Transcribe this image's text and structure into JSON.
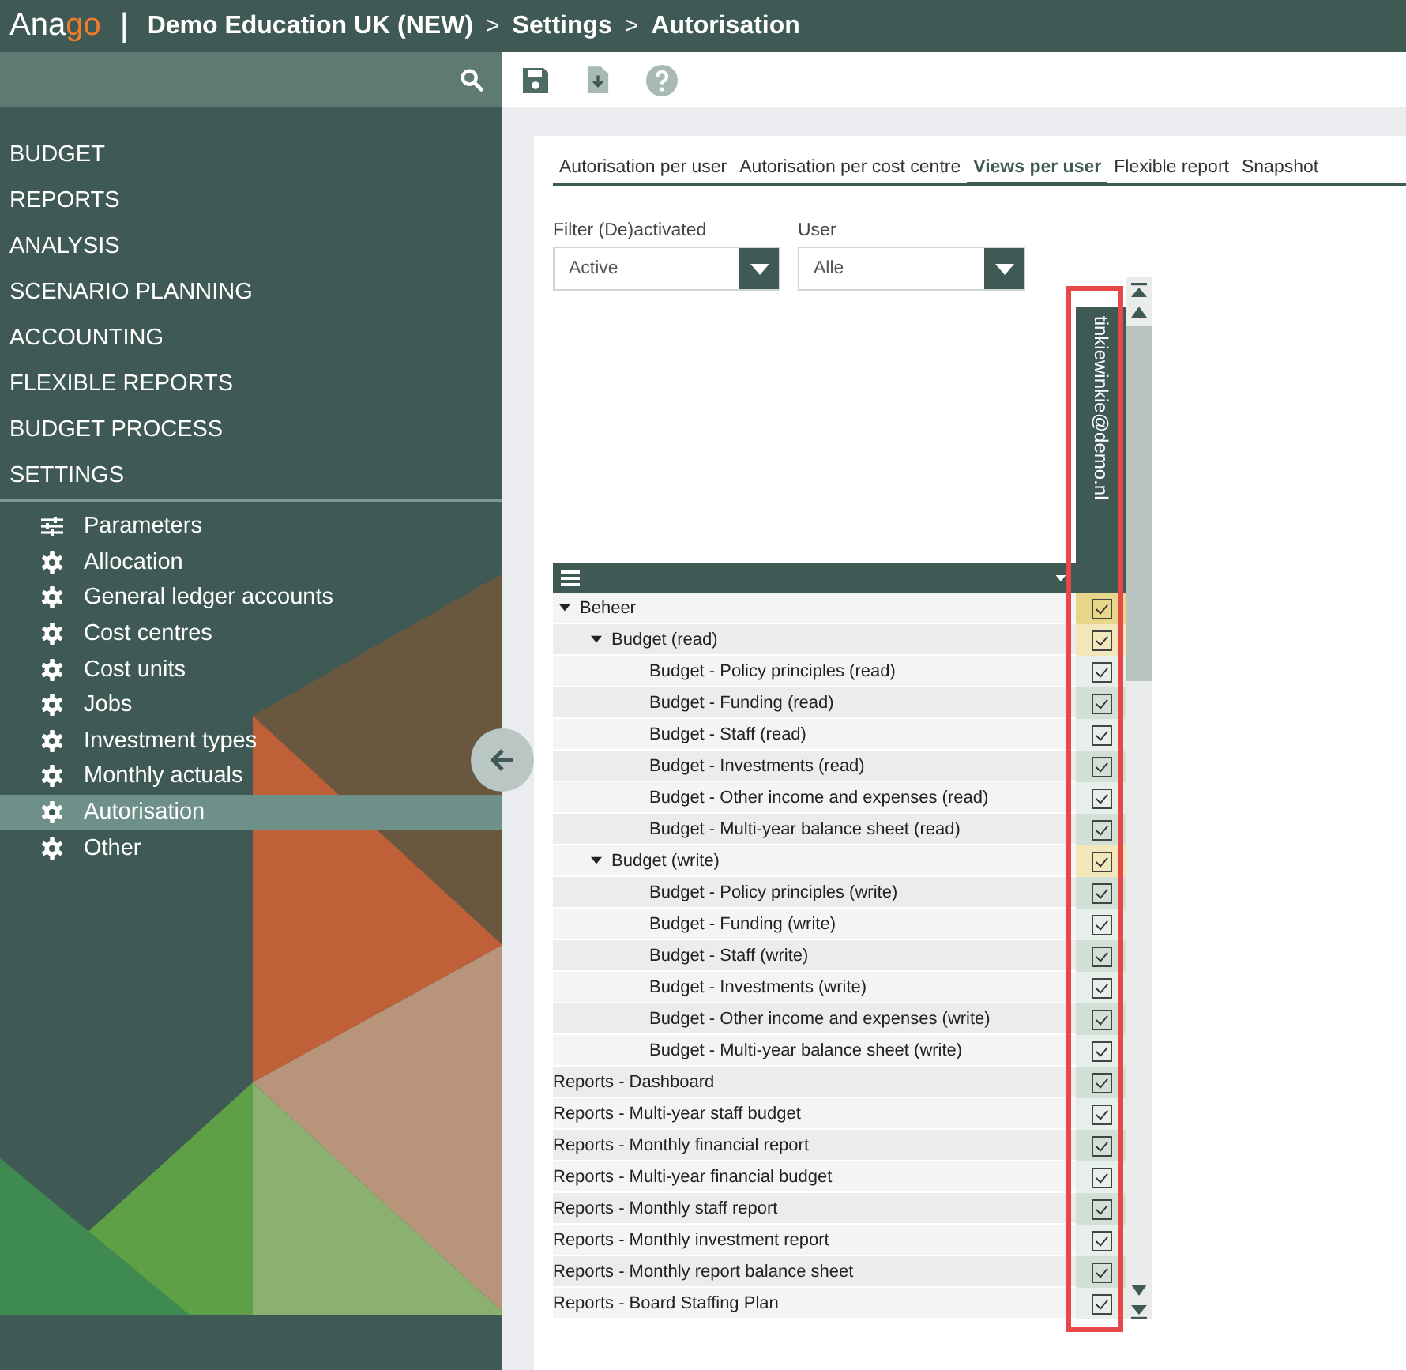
{
  "header": {
    "logo_main": "Ana",
    "logo_accent": "go",
    "separator": "|",
    "crumbs": [
      "Demo Education UK (NEW)",
      "Settings",
      "Autorisation"
    ],
    "crumb_separator": ">"
  },
  "sidebar": {
    "sections": [
      {
        "label": "BUDGET"
      },
      {
        "label": "REPORTS"
      },
      {
        "label": "ANALYSIS"
      },
      {
        "label": "SCENARIO PLANNING"
      },
      {
        "label": "ACCOUNTING"
      },
      {
        "label": "FLEXIBLE REPORTS"
      },
      {
        "label": "BUDGET PROCESS"
      },
      {
        "label": "SETTINGS"
      }
    ],
    "items": [
      {
        "label": "Parameters",
        "kind": "sliders",
        "selected": false
      },
      {
        "label": "Allocation",
        "kind": "gear",
        "selected": false
      },
      {
        "label": "General ledger accounts",
        "kind": "gear",
        "selected": false
      },
      {
        "label": "Cost centres",
        "kind": "gear",
        "selected": false
      },
      {
        "label": "Cost units",
        "kind": "gear",
        "selected": false
      },
      {
        "label": "Jobs",
        "kind": "gear",
        "selected": false
      },
      {
        "label": "Investment types",
        "kind": "gear",
        "selected": false
      },
      {
        "label": "Monthly actuals",
        "kind": "gear",
        "selected": false
      },
      {
        "label": "Autorisation",
        "kind": "gear",
        "selected": true
      },
      {
        "label": "Other",
        "kind": "gear",
        "selected": false
      }
    ]
  },
  "tabs": [
    {
      "label": "Autorisation per user",
      "selected": false
    },
    {
      "label": "Autorisation per cost centre",
      "selected": false
    },
    {
      "label": "Views per user",
      "selected": true
    },
    {
      "label": "Flexible report",
      "selected": false
    },
    {
      "label": "Snapshot",
      "selected": false
    }
  ],
  "filters": [
    {
      "label": "Filter (De)activated",
      "value": "Active"
    },
    {
      "label": "User",
      "value": "Alle"
    }
  ],
  "grid": {
    "user_column": "tinkiewinkie@demo.nl",
    "rows": [
      {
        "label": "Beheer",
        "kind": "group",
        "expanded": true,
        "checked": true,
        "children": [
          {
            "label": "Budget (read)",
            "kind": "group",
            "expanded": true,
            "checked": true,
            "children": [
              {
                "label": "Budget - Policy principles (read)",
                "kind": "item",
                "checked": true
              },
              {
                "label": "Budget - Funding (read)",
                "kind": "item",
                "checked": true
              },
              {
                "label": "Budget - Staff (read)",
                "kind": "item",
                "checked": true
              },
              {
                "label": "Budget - Investments (read)",
                "kind": "item",
                "checked": true
              },
              {
                "label": "Budget - Other income and expenses (read)",
                "kind": "item",
                "checked": true
              },
              {
                "label": "Budget - Multi-year balance sheet (read)",
                "kind": "item",
                "checked": true
              }
            ]
          },
          {
            "label": "Budget (write)",
            "kind": "group",
            "expanded": true,
            "checked": true,
            "children": [
              {
                "label": "Budget - Policy principles (write)",
                "kind": "item",
                "checked": true
              },
              {
                "label": "Budget - Funding (write)",
                "kind": "item",
                "checked": true
              },
              {
                "label": "Budget - Staff (write)",
                "kind": "item",
                "checked": true
              },
              {
                "label": "Budget - Investments (write)",
                "kind": "item",
                "checked": true
              },
              {
                "label": "Budget - Other income and expenses (write)",
                "kind": "item",
                "checked": true
              },
              {
                "label": "Budget - Multi-year balance sheet (write)",
                "kind": "item",
                "checked": true
              }
            ]
          }
        ]
      },
      {
        "label": "Reports - Dashboard",
        "kind": "item",
        "checked": true
      },
      {
        "label": "Reports - Multi-year staff budget",
        "kind": "item",
        "checked": true
      },
      {
        "label": "Reports - Monthly financial report",
        "kind": "item",
        "checked": true
      },
      {
        "label": "Reports - Multi-year financial budget",
        "kind": "item",
        "checked": true
      },
      {
        "label": "Reports - Monthly staff report",
        "kind": "item",
        "checked": true
      },
      {
        "label": "Reports - Monthly investment report",
        "kind": "item",
        "checked": true
      },
      {
        "label": "Reports - Monthly report balance sheet",
        "kind": "item",
        "checked": true
      },
      {
        "label": "Reports - Board Staffing Plan",
        "kind": "item",
        "checked": true
      }
    ]
  }
}
